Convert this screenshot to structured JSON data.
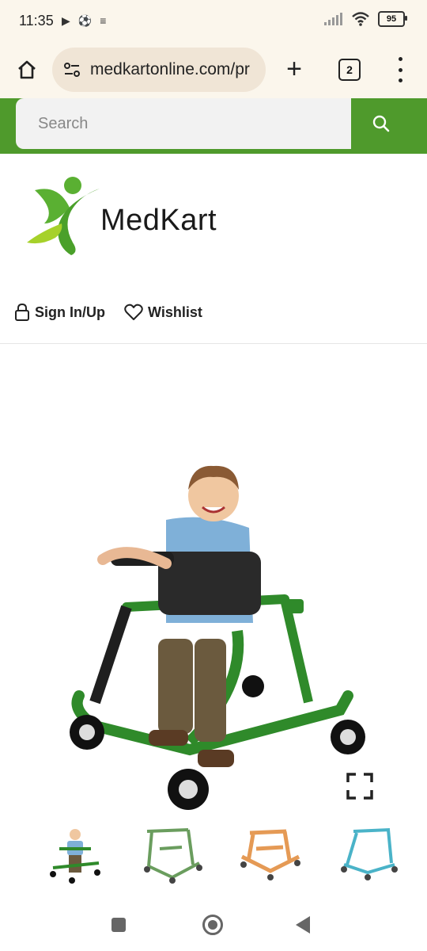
{
  "status_bar": {
    "time": "11:35",
    "battery": "95"
  },
  "browser": {
    "url": "medkartonline.com/pr",
    "tab_count": "2"
  },
  "search": {
    "placeholder": "Search"
  },
  "logo": {
    "text": "MedKart"
  },
  "account": {
    "sign_in": "Sign In/Up",
    "wishlist": "Wishlist"
  },
  "colors": {
    "brand_green": "#4f9a2c",
    "frame_green": "#2f8a2a",
    "thumb_orange": "#e59a55",
    "thumb_blue": "#4ab3c8"
  },
  "product": {
    "thumbnails": [
      "green-with-child",
      "green",
      "orange",
      "blue"
    ]
  }
}
